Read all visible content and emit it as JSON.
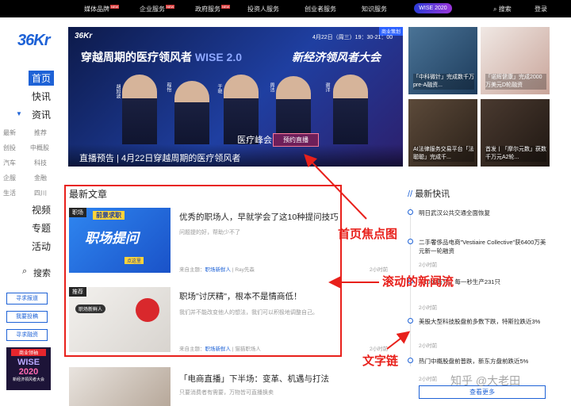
{
  "topbar": {
    "items": [
      "媒体品牌",
      "企业服务",
      "政府服务",
      "投资人服务",
      "创业者服务",
      "知识服务"
    ],
    "new_flag": "NEW",
    "wise_pill": "WISE 2020",
    "search": "搜索",
    "login": "登录"
  },
  "logo": "36Kr",
  "sidebar": {
    "main": [
      "首页",
      "快讯",
      "资讯",
      "视频",
      "专题",
      "活动"
    ],
    "sub": [
      "最新",
      "推荐",
      "创投",
      "中概股",
      "汽车",
      "科技",
      "企服",
      "金融",
      "生活",
      "四川"
    ],
    "search": "搜索",
    "buttons": [
      "寻求报道",
      "我要投稿",
      "寻求融资"
    ],
    "ad": {
      "line1": "商业领袖",
      "line2": "WISE",
      "line3": "2020",
      "line4": "新经济领风者大会"
    }
  },
  "hero": {
    "tag": "商业策划",
    "date": "4月22日（周三）19：30-21：00",
    "title_left": "穿越周期的医疗领风者",
    "wise": "WISE 2.0",
    "title_right": "新经济领风者大会",
    "summit": "医疗峰会",
    "live": "预约直播",
    "caption": "直播预告 | 4月22日穿越周期的医疗领风者",
    "people": [
      "胡旭波",
      "程怡",
      "于晓",
      "周洁",
      "谢洋"
    ]
  },
  "thumbs": [
    {
      "title": "「中科微针」完成数千万pre-A融资..."
    },
    {
      "title": "「诺辉健康」完成2000万美元D轮融资"
    },
    {
      "title": "AI法律服务交易平台「法聪聪」完成千..."
    },
    {
      "title": "首发丨「摩尔元数」获数千万元A2轮..."
    }
  ],
  "latest": {
    "title": "最新文章",
    "articles": [
      {
        "badge": "职场",
        "img_text1": "前景求职",
        "img_text2": "职场提问",
        "img_text3": "点这里",
        "title": "优秀的职场人，早就学会了这10种提问技巧",
        "desc": "问题提的好，帮助少不了",
        "source": "来自主题：",
        "topic": "职场新鲜人",
        "author": "Ray先森",
        "time": "2小时前"
      },
      {
        "badge": "推荐",
        "img_text1": "职场新鲜人",
        "img_text2": "",
        "img_text3": "",
        "title": "职场\"讨厌精\"，根本不是情商低！",
        "desc": "我们并不能改变他人的想法，我们可以积极地调整自己。",
        "source": "来自主题：",
        "topic": "职场新鲜人",
        "author": "猫猫职场人",
        "time": "2小时前"
      },
      {
        "badge": "",
        "img_text1": "",
        "img_text2": "",
        "img_text3": "",
        "title": "「电商直播」下半场：变革、机遇与打法",
        "desc": "只要消费者有需要，万物皆可直播换卖",
        "source": "",
        "topic": "",
        "author": "",
        "time": ""
      }
    ]
  },
  "flash": {
    "title": "最新快讯",
    "items": [
      {
        "text": "明日武汉公共交通全面恢复",
        "time": ""
      },
      {
        "text": "二手奢侈品电商\"Vestiaire Collective\"获6400万美元新一轮融资",
        "time": "2小时前"
      },
      {
        "text": "...1000万只，每一秒生产231只",
        "time": "2小时前"
      },
      {
        "text": "美股大型科技股盘前多数下跌，特斯拉跌近3%",
        "time": "2小时前"
      },
      {
        "text": "热门中概股盘前普跌，新东方盘前跌近5%",
        "time": "2小时前"
      }
    ],
    "more": "查看更多"
  },
  "annotations": {
    "focus": "首页焦点图",
    "news": "滚动的新闻流",
    "textlink": "文字链"
  },
  "watermark": "知乎 @大老田"
}
